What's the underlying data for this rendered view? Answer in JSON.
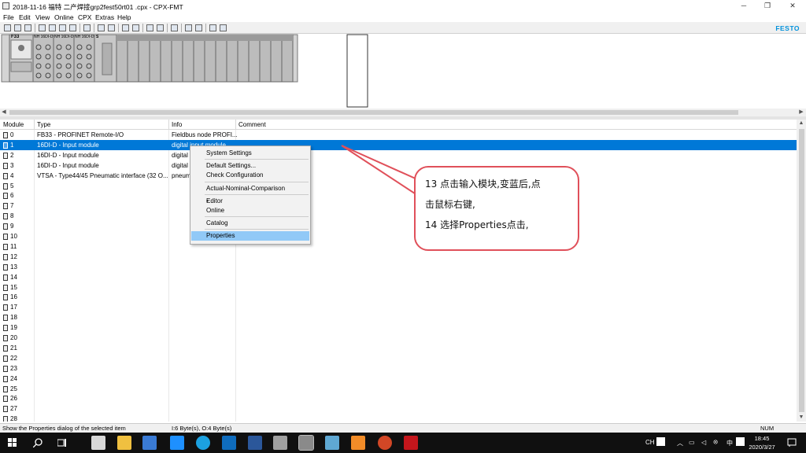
{
  "window": {
    "title": "2018-11-16 福特 二产焊接grp2fest50rt01 .cpx - CPX-FMT",
    "minimize": "─",
    "maximize": "❐",
    "close": "✕"
  },
  "menu": [
    "File",
    "Edit",
    "View",
    "Online",
    "CPX",
    "Extras",
    "Help"
  ],
  "brand": "FESTO",
  "hardware": {
    "node_label": "F33",
    "module_labels": [
      "NH 16DI-D",
      "NH 16DI-D",
      "NH 16DI-D",
      "S"
    ]
  },
  "columns": [
    "Module",
    "Type",
    "Info",
    "Comment"
  ],
  "rows": [
    {
      "module": "0",
      "type": "FB33 - PROFINET Remote-I/O",
      "info": "Fieldbus node PROFI..."
    },
    {
      "module": "1",
      "type": "16DI-D - Input module",
      "info": "digital input module",
      "selected": true
    },
    {
      "module": "2",
      "type": "16DI-D - Input module",
      "info": "digital"
    },
    {
      "module": "3",
      "type": "16DI-D - Input module",
      "info": "digital"
    },
    {
      "module": "4",
      "type": "VTSA - Type44/45 Pneumatic interface (32 O...",
      "info": "pneum"
    },
    {
      "module": "5"
    },
    {
      "module": "6"
    },
    {
      "module": "7"
    },
    {
      "module": "8"
    },
    {
      "module": "9"
    },
    {
      "module": "10"
    },
    {
      "module": "11"
    },
    {
      "module": "12"
    },
    {
      "module": "13"
    },
    {
      "module": "14"
    },
    {
      "module": "15"
    },
    {
      "module": "16"
    },
    {
      "module": "17"
    },
    {
      "module": "18"
    },
    {
      "module": "19"
    },
    {
      "module": "20"
    },
    {
      "module": "21"
    },
    {
      "module": "22"
    },
    {
      "module": "23"
    },
    {
      "module": "24"
    },
    {
      "module": "25"
    },
    {
      "module": "26"
    },
    {
      "module": "27"
    },
    {
      "module": "28"
    }
  ],
  "context_menu": [
    {
      "label": "System Settings"
    },
    {
      "separator": true
    },
    {
      "label": "Default Settings..."
    },
    {
      "label": "Check Configuration"
    },
    {
      "separator": true
    },
    {
      "label": "Actual-Nominal-Comparison"
    },
    {
      "separator": true
    },
    {
      "label": "Editor",
      "checked": true
    },
    {
      "label": "Online"
    },
    {
      "separator": true
    },
    {
      "label": "Catalog"
    },
    {
      "separator": true
    },
    {
      "label": "Properties",
      "highlighted": true
    }
  ],
  "callout": {
    "line1": "13 点击输入模块,变蓝后,点",
    "line2": "击鼠标右键,",
    "line3": "14 选择Properties点击,"
  },
  "status": {
    "hint": "Show the Properties dialog of the selected item",
    "io": "I:6 Byte(s), O:4 Byte(s)",
    "num": "NUM"
  },
  "taskbar": {
    "lang": "CH",
    "ime": "中",
    "time": "18:45",
    "date": "2020/3/27"
  },
  "colors": {
    "selection": "#0078d7",
    "menu_highlight": "#91c9f7",
    "callout_border": "#e0505a",
    "festo_blue": "#0091dc"
  }
}
